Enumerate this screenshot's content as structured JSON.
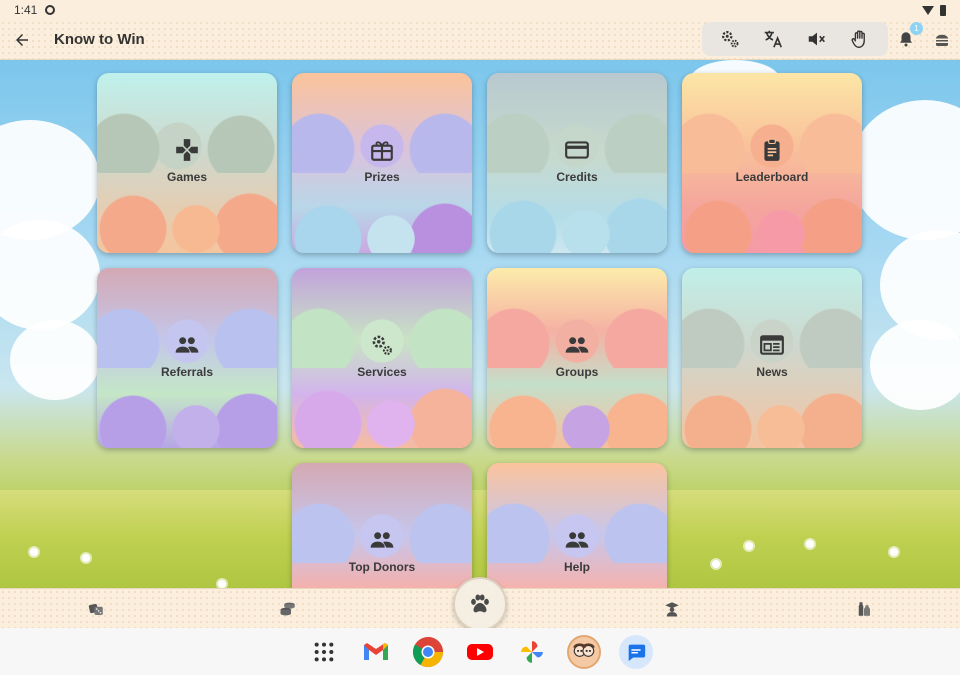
{
  "status_bar": {
    "time": "1:41"
  },
  "app_bar": {
    "title": "Know to Win",
    "notification_count": "1"
  },
  "tiles": [
    {
      "label": "Games",
      "icon": "gamepad-icon"
    },
    {
      "label": "Prizes",
      "icon": "gift-icon"
    },
    {
      "label": "Credits",
      "icon": "card-icon"
    },
    {
      "label": "Leaderboard",
      "icon": "clipboard-icon"
    },
    {
      "label": "Referrals",
      "icon": "people-icon"
    },
    {
      "label": "Services",
      "icon": "gears-icon"
    },
    {
      "label": "Groups",
      "icon": "people-icon"
    },
    {
      "label": "News",
      "icon": "newspaper-icon"
    },
    {
      "label": "Top Donors",
      "icon": "people-icon"
    },
    {
      "label": "Help",
      "icon": "people-icon"
    }
  ],
  "bottom_nav": [
    "dice-icon",
    "coins-icon",
    "teacher-icon",
    "paw-icon",
    "bottles-icon"
  ],
  "dock": [
    "app-grid-icon",
    "gmail-icon",
    "chrome-icon",
    "youtube-icon",
    "photos-icon",
    "avatar-app-icon",
    "messages-icon"
  ]
}
